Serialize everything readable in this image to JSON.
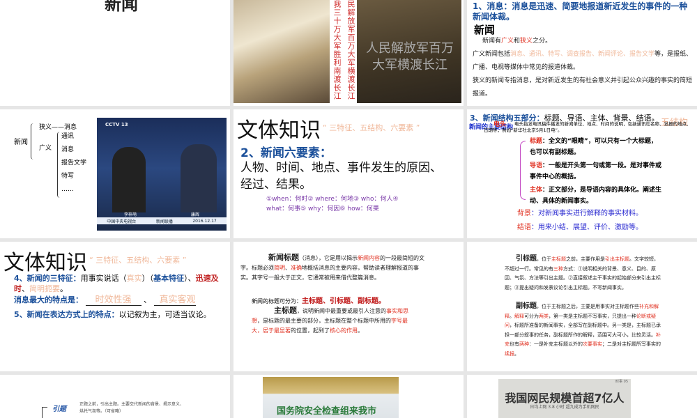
{
  "s1": {
    "title_fragment": "新闻"
  },
  "s2": {
    "caption_left": "我三十万大军胜利南渡长江",
    "caption_right": "民解放军百万大军横渡长江",
    "overlay": "人民解放军百万大军横渡长江"
  },
  "s3": {
    "heading": "1、消息：消息是迅速、简要地报道新近发生的事件的一种新闻体裁。",
    "subtitle": "新闻",
    "l1a": "新闻有",
    "l1b": "广义",
    "l1c": "和",
    "l1d": "狭义",
    "l1e": "之分。",
    "l2a": "广义新闻包括",
    "l2b": "消息、通讯、特写、调查报告、新闻评论、报告文学",
    "l2c": "等，是报纸、广播、电视等媒体中常见的报道体裁。",
    "l3": "狭义的新闻专指消息，是对新近发生的有社会意义并引起公众兴趣的事实的简短报道。"
  },
  "s4": {
    "root": "新闻",
    "narrow": "狭义——消息",
    "broad": "广义",
    "items": [
      "通讯",
      "消息",
      "报告文学",
      "特写",
      "……"
    ],
    "tv": {
      "logo": "CCTV 13",
      "name1": "李梓萌",
      "name2": "康辉",
      "station": "中国中央电视台",
      "program": "新闻联播",
      "date": "2016.12.17"
    }
  },
  "s5": {
    "title": "文体知识",
    "tag": "“ 三特征、五结构、六要素 ”",
    "heading": "2、新闻六要素：",
    "body": "人物、时间、地点、事件发生的原因、经过、结果。",
    "w": "①when：何时② where：何地③ who：何人④ what：何事⑤ why：何因⑥ how：何果"
  },
  "s6": {
    "heading": "3、新闻结构五部分：",
    "heading_rest": "标题、导语、主体、背景、结语。",
    "tag": "五结构",
    "overlap1": "新闻的主要结构",
    "overlap2": "电头",
    "note": "电头指发电讯稿件播发的新闻单位、地点、时间的说明，包括通讯社名称、发报的地点、日期等，例如“新华社北京5月1日电”。",
    "items": [
      {
        "k": "标题",
        "v": "：全文的“眼睛”，可以只有一个大标题，也可以有副标题。"
      },
      {
        "k": "导语",
        "v": "：一般是开头第一句或第一段。是对事件或事件中心的概括。"
      },
      {
        "k": "主体",
        "v": "：正文部分，是导语内容的具体化。阐述生动、具体的新闻事实。"
      }
    ],
    "bg_k": "背景",
    "bg_v": "：对新闻事实进行解释的事实材料。",
    "end_k": "结语",
    "end_v": "：用来小结、展望、评价、激励等。"
  },
  "s7": {
    "title": "文体知识",
    "tag": "“ 三特征、五结构、六要素 ”",
    "l4a": "4、新闻的三特征：",
    "l4b": "用事实说话（",
    "l4c": "真实",
    "l4d": "）（",
    "l4e": "基本特征",
    "l4f": "）、",
    "l4g": "迅速及时",
    "l4h": "、",
    "l4i": "简明扼要",
    "l4j": "。",
    "l5": "消息最大的特点是：",
    "blank1": "时效性强",
    "blank2": "真实客观",
    "l6a": "5、新闻在表达方式上的特点：",
    "l6b": "以记叙为主，可适当议论。"
  },
  "s8": {
    "p1a": "新闻标题",
    "p1b": "（消息），它是用以揭示",
    "p1c": "新闻内容",
    "p1d": "的一段最简短的文字。标题必须",
    "p1e": "简明",
    "p1f": "、",
    "p1g": "准确",
    "p1h": "地概括消息的主要内容，帮助读者理解报道的事实。其字号一般大于正文，它通常被用来借代整篇消息。",
    "p2a": "新闻的标题可分为：",
    "p2b": "主标题、引标题、副标题。",
    "p3a": "主标题",
    "p3b": "，说明新闻中最重要或最引人注意的",
    "p3c": "事实和思想",
    "p3d": "，是标题的最主要的部分，主标题在整个标题中所用的",
    "p3e": "字号最大，居于最显著",
    "p3f": "的位置，起到了",
    "p3g": "核心的作用",
    "p3h": "。"
  },
  "s9": {
    "a1": "引标题",
    "a2": "，位于",
    "a3": "主标题",
    "a4": "之前，主要作用是",
    "a5": "引出主标题",
    "a6": "。文字较短，不超过一行。常见的有",
    "a7": "三种",
    "a8": "方式：①说明相关的背景、意义、目的、原因、气氛、方法等引出主题。②直接叙述主干事实的起始部分来引出主标题；③提出疑问和发表议论引出主标题。不写新闻事实。",
    "b1": "副标题",
    "b2": "，位于主标题之后，主要是用事实对主标题作些",
    "b3": "补充和解释",
    "b4": "。",
    "b5": "解释",
    "b6": "可分为",
    "b7": "两类",
    "b8": "，第一类是主标题不写事实，只提出一种",
    "b9": "论断或疑问",
    "b10": "，标题所准备的新闻事实，全部写在副标题中。另一类是，主标题已承担一部分叙事的任务，副标题所作的解释，范围可大可小，比较灵活。",
    "b11": "补充",
    "b12": "也有",
    "b13": "两种",
    "b14": "：一是补充主标题以外的",
    "b15": "次要事实",
    "b16": "；二是对主标题所写事实的",
    "b17": "续报",
    "b18": "。"
  },
  "s10": {
    "label": "引题",
    "desc": "正题之前，引出主题。主要交代新闻的背景、揭示意义、烘托气氛等。（可省略）"
  },
  "s11": {
    "headline": "国务院安全检查组来我市"
  },
  "s12": {
    "masthead": "时事 05",
    "headline": "我国网民规模首超7亿人",
    "sub": "日均上网 3.8 小时  超九成为手机网民"
  }
}
